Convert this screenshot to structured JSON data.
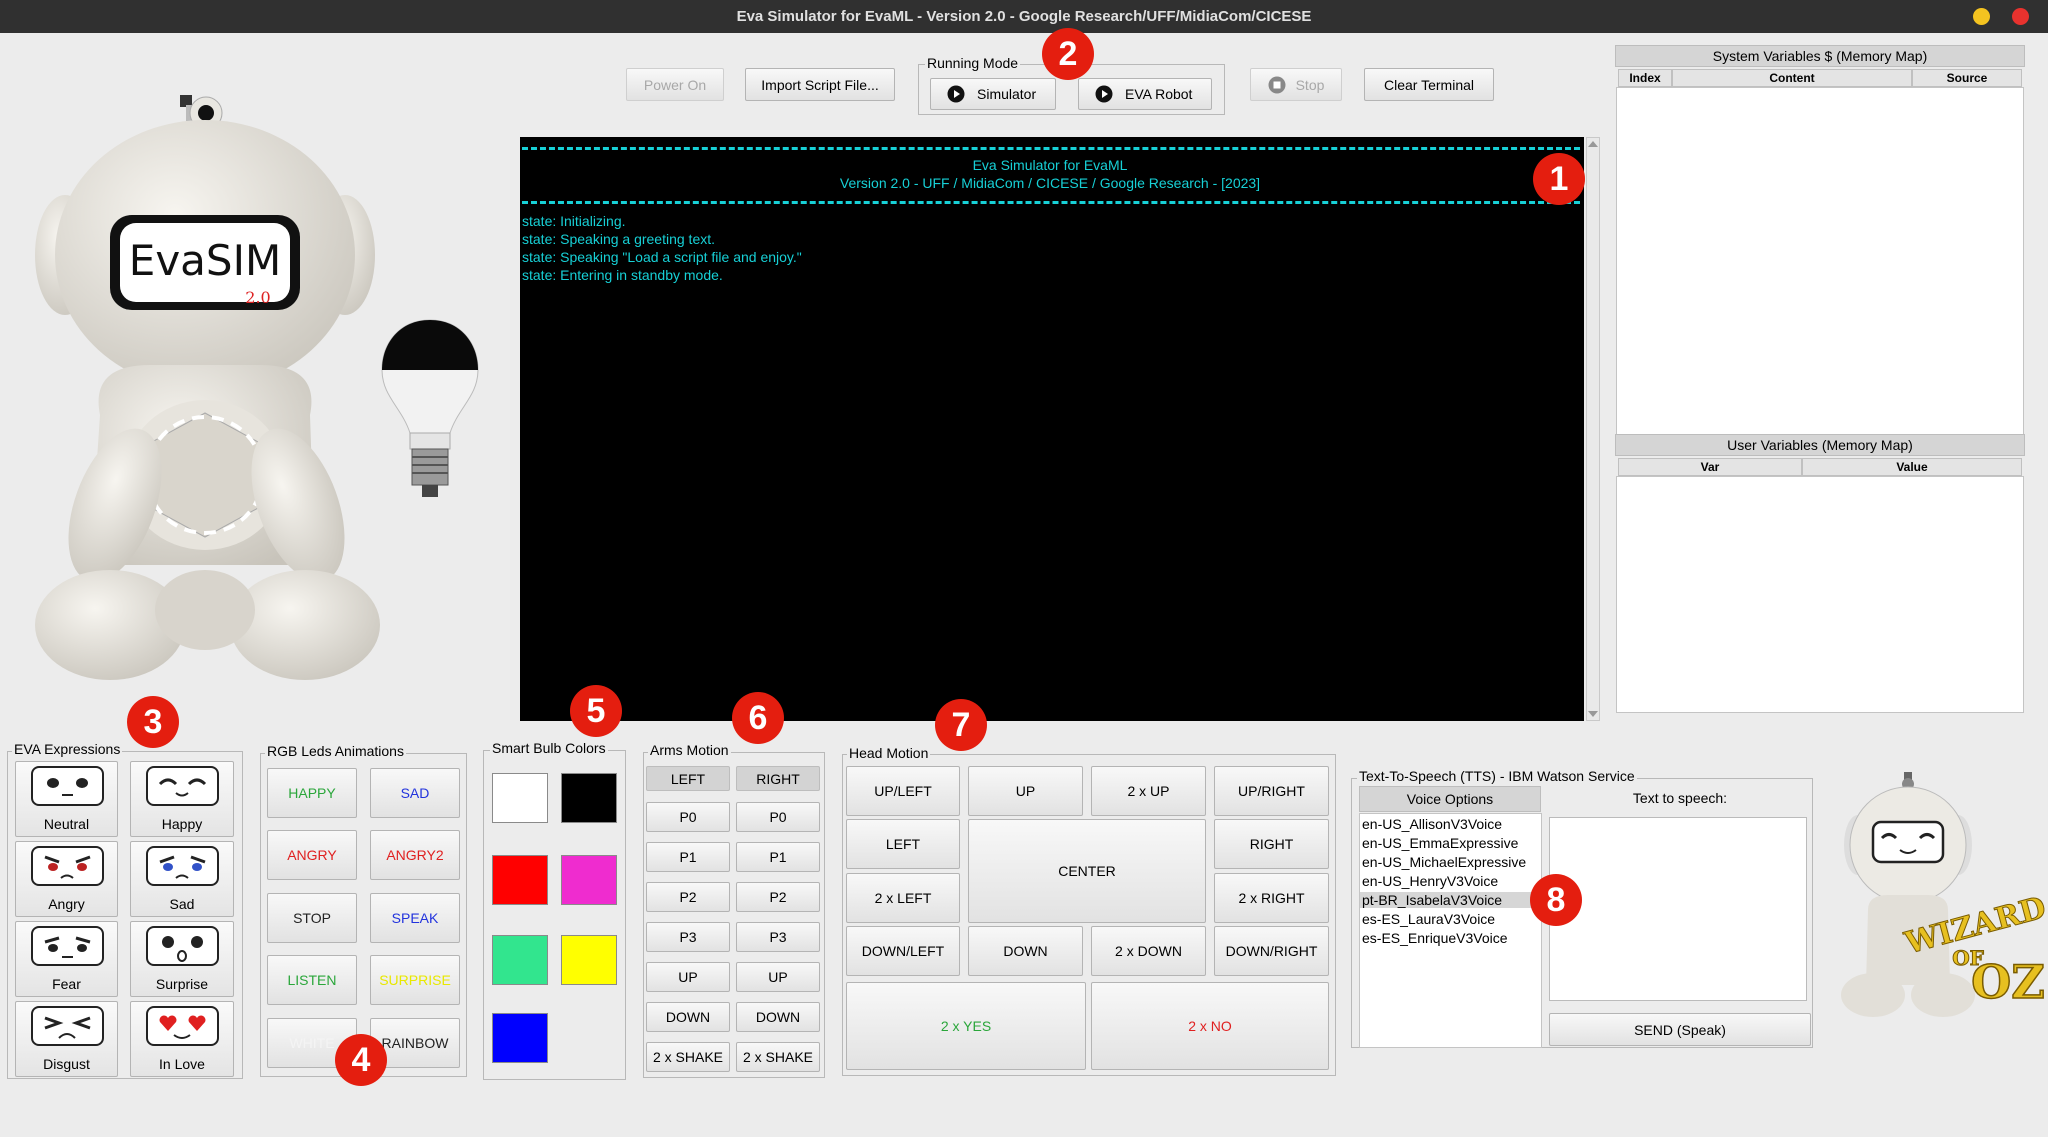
{
  "window": {
    "title": "Eva Simulator for EvaML - Version 2.0 - Google Research/UFF/MidiaCom/CICESE",
    "controls": [
      "minimize",
      "close"
    ]
  },
  "toolbar": {
    "power_on": "Power On",
    "import_script": "Import Script File...",
    "running_mode_label": "Running Mode",
    "simulator": "Simulator",
    "eva_robot": "EVA Robot",
    "stop": "Stop",
    "clear_terminal": "Clear Terminal"
  },
  "robot": {
    "logo_text": "EvaSIM",
    "logo_version": "2.0"
  },
  "terminal": {
    "header_title": "Eva Simulator for EvaML",
    "header_subtitle": "Version 2.0 - UFF / MidiaCom / CICESE / Google Research - [2023]",
    "lines": [
      "state: Initializing.",
      "state: Speaking a greeting text.",
      "state: Speaking \"Load a script file and enjoy.\"",
      "state: Entering in standby mode."
    ],
    "text_color": "#17d0d6"
  },
  "system_vars": {
    "title": "System Variables $ (Memory Map)",
    "columns": [
      "Index",
      "Content",
      "Source"
    ]
  },
  "user_vars": {
    "title": "User Variables (Memory Map)",
    "columns": [
      "Var",
      "Value"
    ]
  },
  "expressions": {
    "label": "EVA Expressions",
    "items": [
      "Neutral",
      "Happy",
      "Angry",
      "Sad",
      "Fear",
      "Surprise",
      "Disgust",
      "In Love"
    ]
  },
  "leds": {
    "label": "RGB Leds Animations",
    "items": [
      {
        "label": "HAPPY",
        "color": "#2aa63a"
      },
      {
        "label": "SAD",
        "color": "#2233dd"
      },
      {
        "label": "ANGRY",
        "color": "#e02020"
      },
      {
        "label": "ANGRY2",
        "color": "#e02020"
      },
      {
        "label": "STOP",
        "color": "#222222"
      },
      {
        "label": "SPEAK",
        "color": "#2233dd"
      },
      {
        "label": "LISTEN",
        "color": "#2aa63a"
      },
      {
        "label": "SURPRISE",
        "color": "#e8e800"
      },
      {
        "label": "WHITE",
        "color": "#f4f4f4"
      },
      {
        "label": "RAINBOW",
        "color": "#222222"
      }
    ]
  },
  "bulb": {
    "label": "Smart Bulb Colors",
    "colors": [
      "#ffffff",
      "#000000",
      "#ff0000",
      "#ef2ccf",
      "#32e58e",
      "#ffff00",
      "#0000ff"
    ]
  },
  "arms": {
    "label": "Arms Motion",
    "left_header": "LEFT",
    "right_header": "RIGHT",
    "rows": [
      "P0",
      "P1",
      "P2",
      "P3",
      "UP",
      "DOWN",
      "2 x SHAKE"
    ]
  },
  "head": {
    "label": "Head Motion",
    "up_left": "UP/LEFT",
    "up": "UP",
    "two_up": "2 x UP",
    "up_right": "UP/RIGHT",
    "left": "LEFT",
    "center": "CENTER",
    "right": "RIGHT",
    "two_left": "2 x LEFT",
    "two_right": "2 x RIGHT",
    "down_left": "DOWN/LEFT",
    "down": "DOWN",
    "two_down": "2 x DOWN",
    "down_right": "DOWN/RIGHT",
    "yes": "2 x YES",
    "no": "2 x NO"
  },
  "tts": {
    "label": "Text-To-Speech (TTS) - IBM Watson Service",
    "voice_header": "Voice Options",
    "text_header": "Text to speech:",
    "voices": [
      "en-US_AllisonV3Voice",
      "en-US_EmmaExpressive",
      "en-US_MichaelExpressive",
      "en-US_HenryV3Voice",
      "pt-BR_IsabelaV3Voice",
      "es-ES_LauraV3Voice",
      "es-ES_EnriqueV3Voice"
    ],
    "selected_voice": "pt-BR_IsabelaV3Voice",
    "send": "SEND (Speak)"
  },
  "wizard": {
    "line1": "WIZARD",
    "line2": "OF",
    "line3": "OZ"
  },
  "badges": [
    "1",
    "2",
    "3",
    "4",
    "5",
    "6",
    "7",
    "8"
  ],
  "colors": {
    "window_bg": "#ececec",
    "titlebar_bg": "#303030",
    "badge": "#e41e0f",
    "minimize": "#f4c320",
    "close": "#e8322e"
  }
}
